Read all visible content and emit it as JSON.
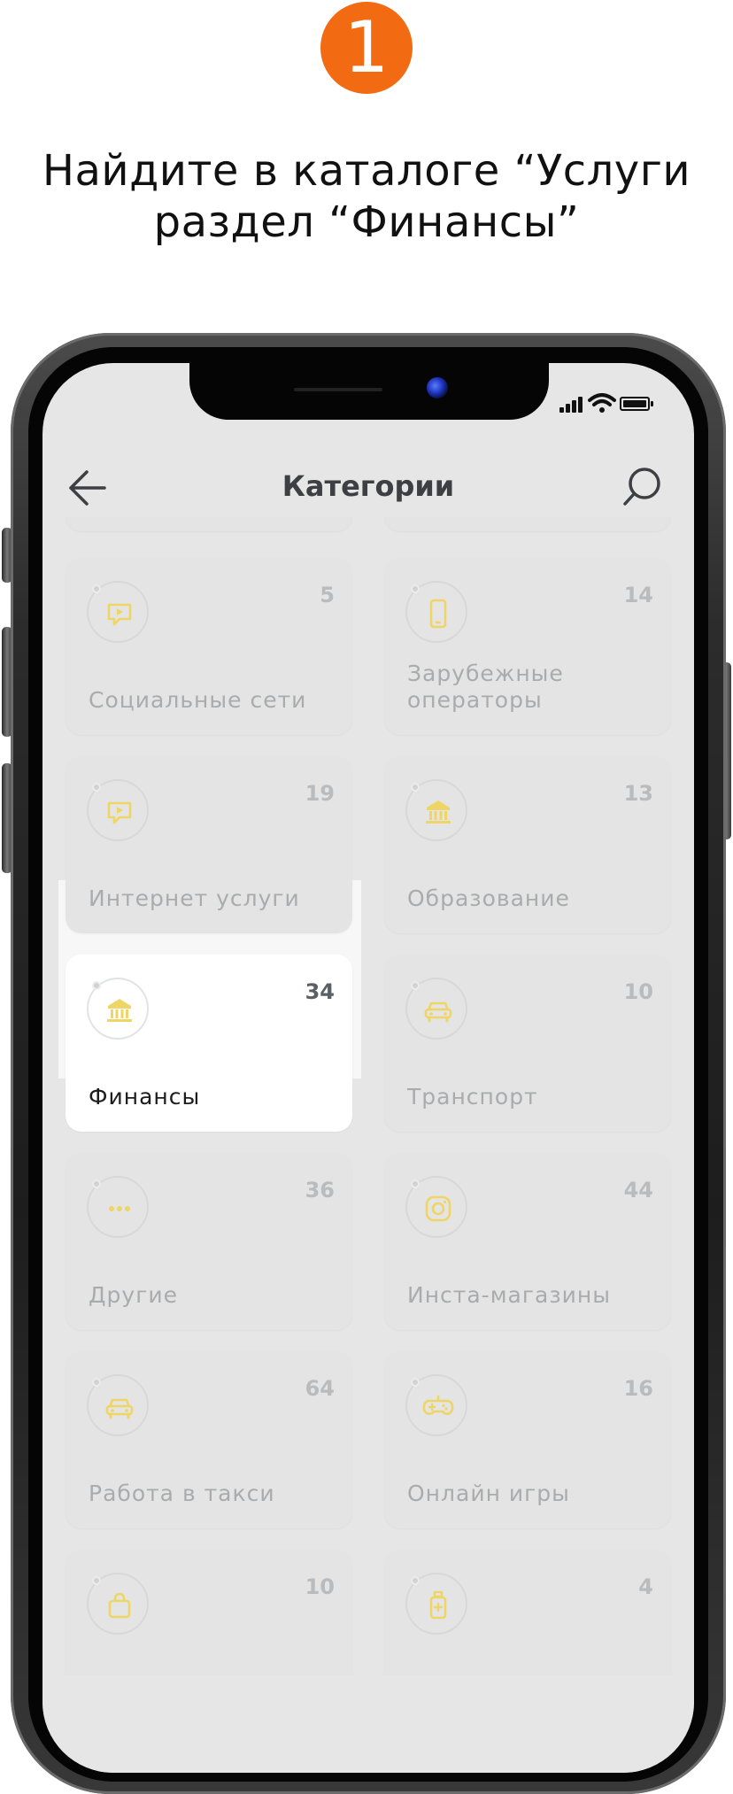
{
  "step": {
    "number": "1"
  },
  "caption": {
    "line1": "Найдите в каталоге “Услуги",
    "line2": "раздел “Финансы”"
  },
  "app": {
    "title": "Категории",
    "back_icon": "arrow-left-icon",
    "search_icon": "search-icon",
    "accent_color": "#f0d24a",
    "badge_color": "#f26a12"
  },
  "categories": [
    {
      "name": "Социальные сети",
      "count": "5",
      "icon": "video-chat-icon"
    },
    {
      "name": "Зарубежные операторы",
      "count": "14",
      "icon": "smartphone-icon"
    },
    {
      "name": "Интернет услуги",
      "count": "19",
      "icon": "video-chat-icon"
    },
    {
      "name": "Образование",
      "count": "13",
      "icon": "bank-icon"
    },
    {
      "name": "Финансы",
      "count": "34",
      "icon": "bank-icon",
      "selected": true
    },
    {
      "name": "Транспорт",
      "count": "10",
      "icon": "car-icon"
    },
    {
      "name": "Другие",
      "count": "36",
      "icon": "more-dots-icon"
    },
    {
      "name": "Инста-магазины",
      "count": "44",
      "icon": "instagram-icon"
    },
    {
      "name": "Работа в такси",
      "count": "64",
      "icon": "car-icon"
    },
    {
      "name": "Онлайн игры",
      "count": "16",
      "icon": "gamepad-icon"
    },
    {
      "name": "",
      "count": "10",
      "icon": "shopping-bag-icon"
    },
    {
      "name": "",
      "count": "4",
      "icon": "bottle-icon"
    }
  ]
}
